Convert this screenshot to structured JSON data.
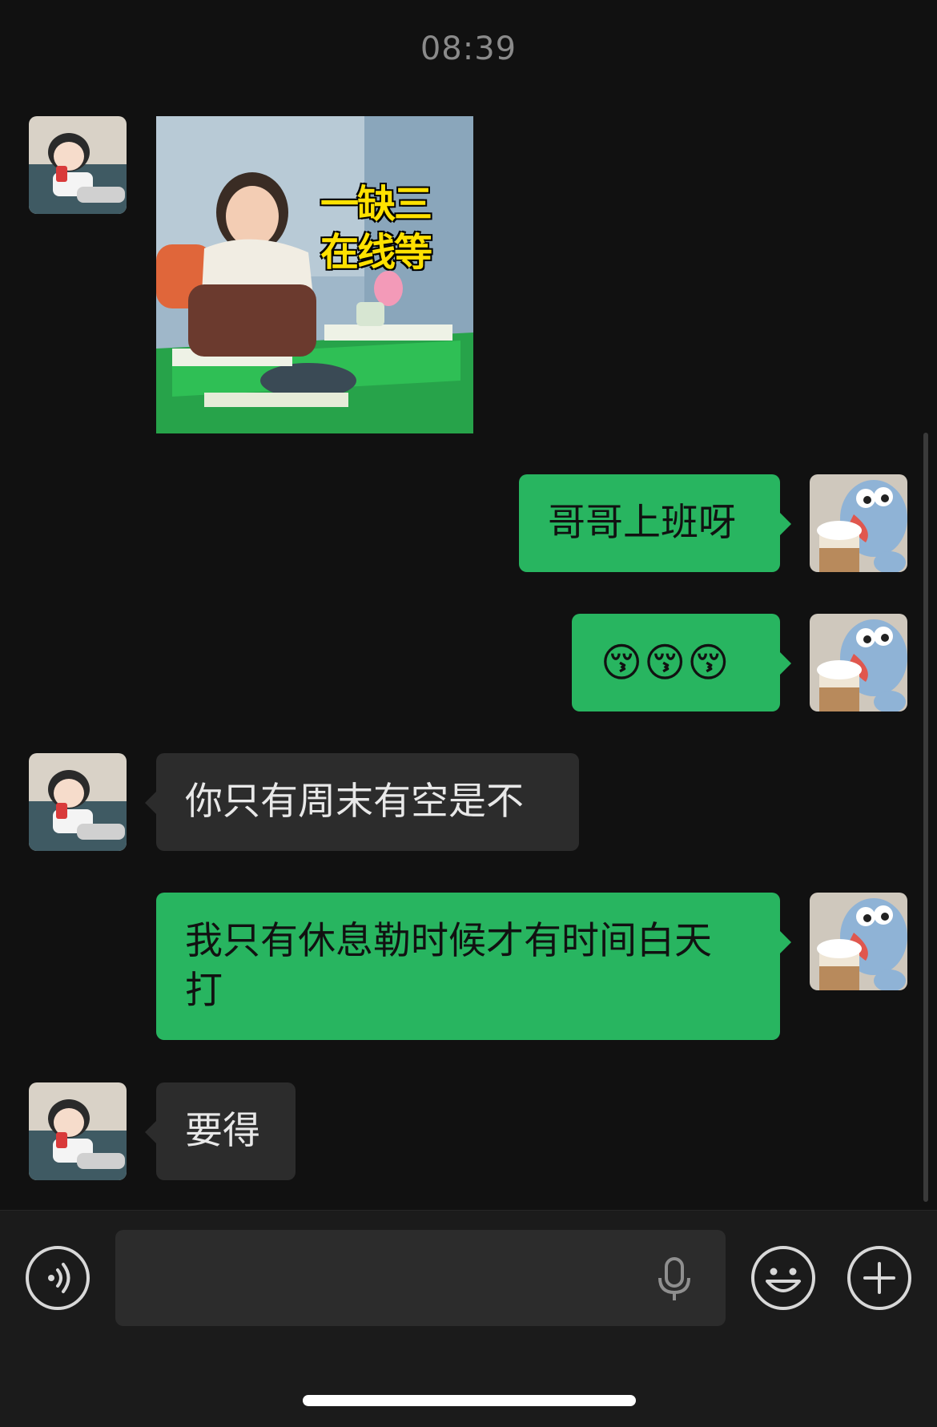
{
  "chat": {
    "timestamp": "08:39",
    "messages": [
      {
        "side": "left",
        "type": "sticker",
        "caption_line1": "一缺三",
        "caption_line2": "在线等"
      },
      {
        "side": "right",
        "type": "text",
        "text": "哥哥上班呀"
      },
      {
        "side": "right",
        "type": "text",
        "text": "😚😚😚"
      },
      {
        "side": "left",
        "type": "text",
        "text": "你只有周末有空是不"
      },
      {
        "side": "right",
        "type": "text",
        "line1": "我只有休息勒时候才有时间白天",
        "line2": "打"
      },
      {
        "side": "left",
        "type": "text",
        "text": "要得"
      }
    ]
  },
  "input_bar": {
    "voice_icon": "voice-icon",
    "mic_icon": "microphone-icon",
    "emoji_icon": "emoji-icon",
    "plus_icon": "plus-icon",
    "placeholder": ""
  },
  "colors": {
    "background": "#111111",
    "incoming_bubble": "#2c2c2c",
    "outgoing_bubble": "#28b560",
    "input_bar": "#1b1b1b"
  }
}
